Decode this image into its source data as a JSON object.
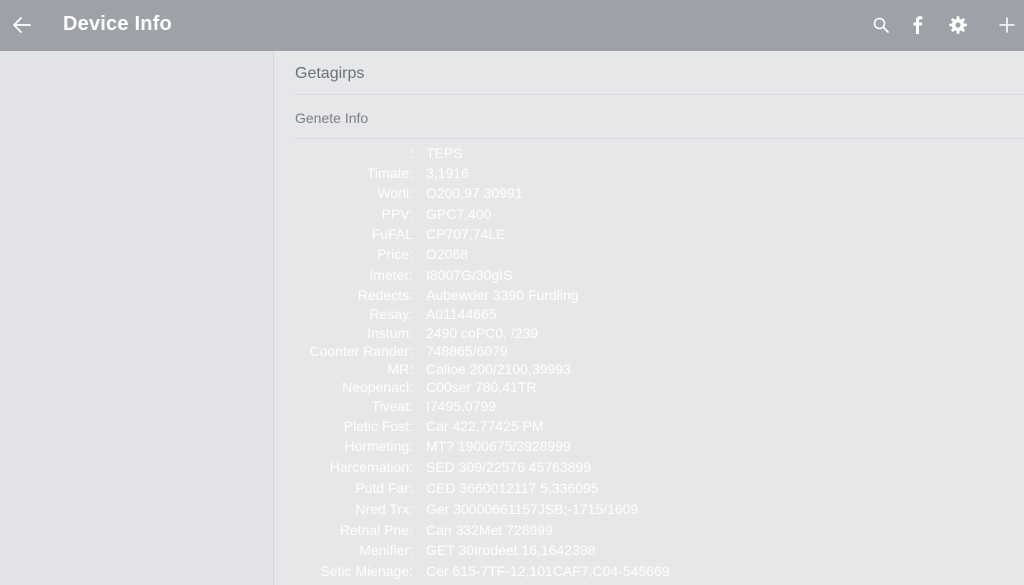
{
  "appbar": {
    "title": "Device Info",
    "back_icon": "arrow-left-icon",
    "actions": [
      "search-icon",
      "facebook-icon",
      "gear-icon",
      "plus-icon"
    ]
  },
  "main": {
    "section_title": "Getagirps",
    "subtitle": "Genete Info",
    "rows": [
      {
        "label": ":",
        "value": "TEPS"
      },
      {
        "label": "Timate:",
        "value": "3,1916"
      },
      {
        "label": "Worli:",
        "value": "O200,97 30991"
      },
      {
        "label": "PPV:",
        "value": "GPC7,400"
      },
      {
        "label": "FuFAL",
        "value": "CP707,74LE"
      },
      {
        "label": "Price:",
        "value": "O2068"
      },
      {
        "label": "Imeter:",
        "value": "I8007G/30gIS"
      },
      {
        "label": "Redects:",
        "value": "Aubewder 3390 Furdling"
      },
      {
        "label": "Resay:",
        "value": "A01144665"
      },
      {
        "label": "Instum:",
        "value": "2490 coPC0, /239"
      },
      {
        "label": "Coonter Rander:",
        "value": "748865/6079"
      },
      {
        "label": "MR:",
        "value": "Calioe 200/2100,39993"
      },
      {
        "label": "Neopenacl:",
        "value": "C00ser 780,41TR"
      },
      {
        "label": "Tiveat:",
        "value": "I7495,0799"
      },
      {
        "label": "Pletic Fost:",
        "value": "Car 422,77425 PM"
      },
      {
        "label": "Hormeting:",
        "value": "MT? 1900675/3928999"
      },
      {
        "label": "Harcemation:",
        "value": "SED 309/22576 45763899"
      },
      {
        "label": "Putd Far:",
        "value": "CED 3660012117 5,336095"
      },
      {
        "label": "Nred Trx:",
        "value": "Ger 30000661157JSB;-1715/1609"
      },
      {
        "label": "Retnal Pne:",
        "value": "Can 332Met 728999"
      },
      {
        "label": "Menifier:",
        "value": "GET 30Irodeet 16,1642398"
      },
      {
        "label": "Setic Mienage:",
        "value": "Cer 615-7TF-12,101CAF7,C04-545669"
      }
    ]
  }
}
